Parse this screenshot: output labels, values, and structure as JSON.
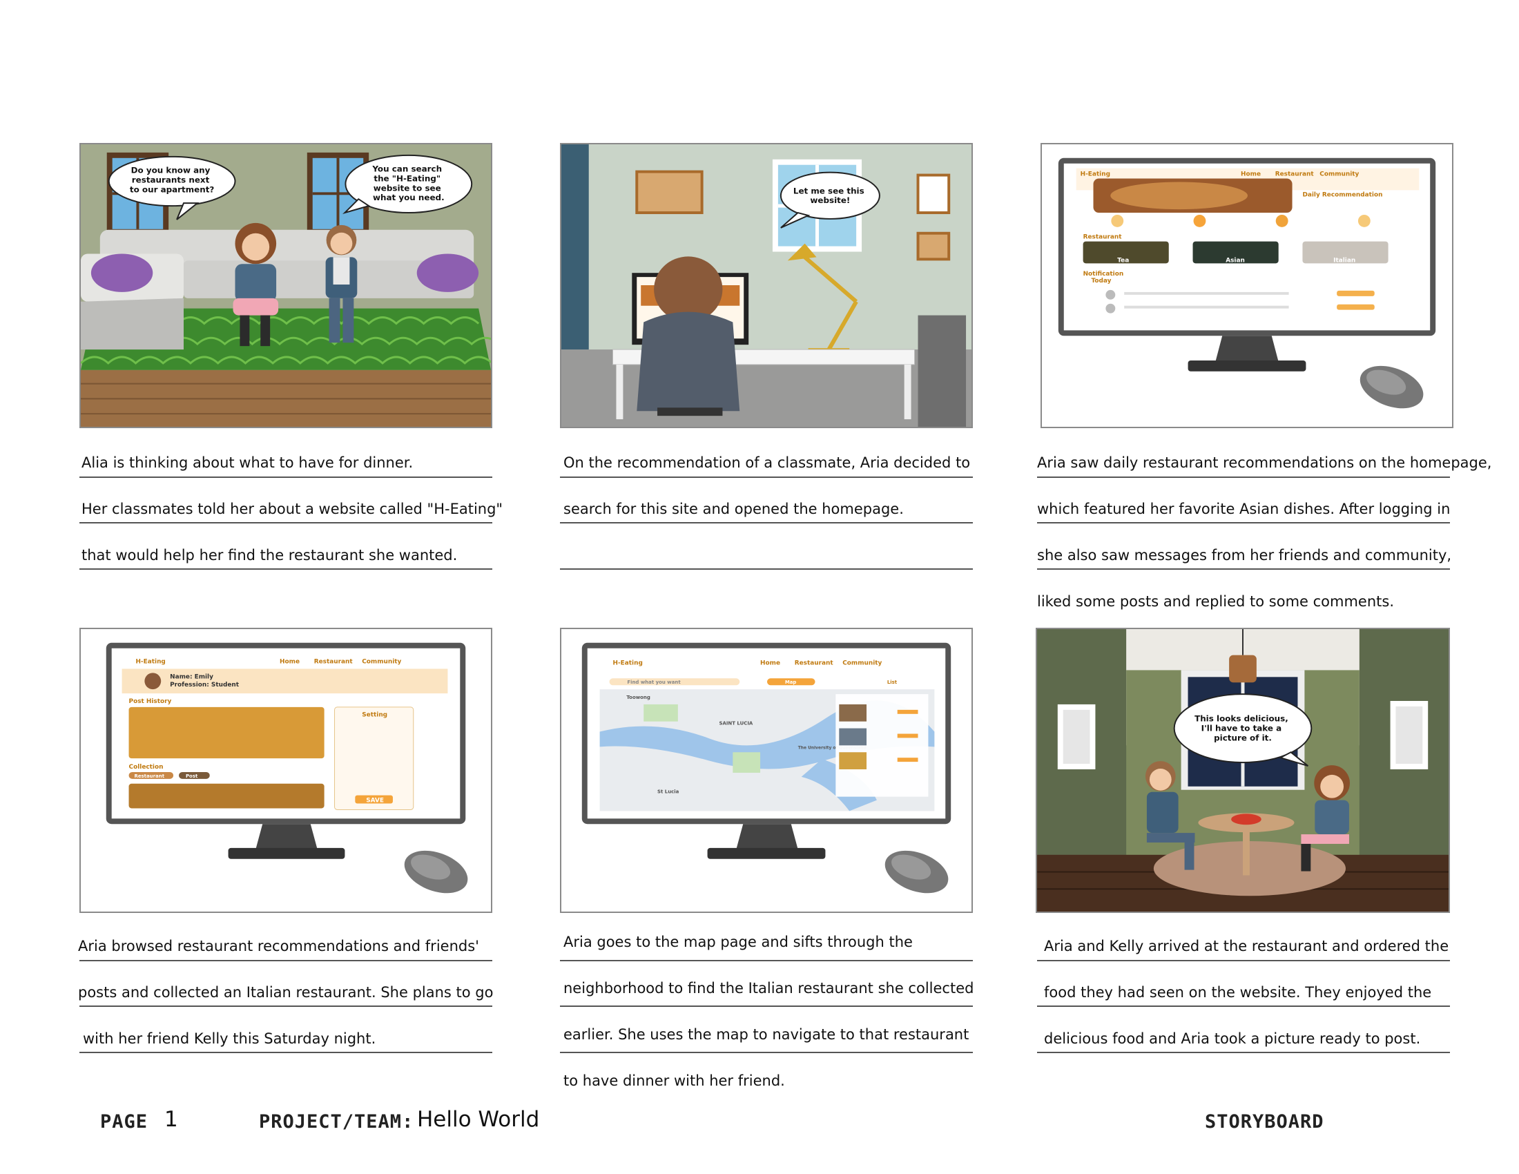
{
  "panels": [
    {
      "id": 1,
      "bubbles": [
        [
          "Do you know any",
          "restaurants next",
          "to our apartment?"
        ],
        [
          "You can search",
          "the \"H-Eating\"",
          "website to see",
          "what you need."
        ]
      ],
      "caption": [
        "Alia is thinking about what to have for dinner.",
        "Her classmates told her about a website called \"H-Eating\"",
        "that would help her find the restaurant she wanted."
      ]
    },
    {
      "id": 2,
      "bubbles": [
        [
          "Let me see this",
          "website!"
        ]
      ],
      "caption": [
        "On the recommendation of a classmate, Aria decided to",
        "search for this site and opened the homepage.",
        ""
      ]
    },
    {
      "id": 3,
      "screen": {
        "brand": "H-Eating",
        "nav": [
          "Home",
          "Restaurant",
          "Community"
        ],
        "hero_title": "Daily Recommendation",
        "section_restaurant": "Restaurant",
        "section_notification": "Notification",
        "today": "Today",
        "food_labels": [
          "Tea",
          "Asian",
          "Italian"
        ]
      },
      "caption": [
        "Aria saw daily restaurant recommendations on the homepage,",
        "which featured her favorite Asian dishes. After logging in",
        "she also saw messages from her friends and community,",
        "liked some posts and replied to some comments."
      ]
    },
    {
      "id": 4,
      "screen": {
        "brand": "H-Eating",
        "nav": [
          "Home",
          "Restaurant",
          "Community"
        ],
        "profile_name": "Name: Emily",
        "profile_role": "Profession: Student",
        "post_history": "Post History",
        "collection": "Collection",
        "collection_tabs": [
          "Restaurant",
          "Post"
        ],
        "setting": "Setting",
        "save": "SAVE"
      },
      "caption": [
        "Aria browsed restaurant recommendations and friends'",
        "posts and collected an Italian restaurant. She plans to go",
        "with her friend Kelly this Saturday night."
      ]
    },
    {
      "id": 5,
      "screen": {
        "brand": "H-Eating",
        "nav": [
          "Home",
          "Restaurant",
          "Community"
        ],
        "search_placeholder": "Find what you want",
        "tabs": [
          "Map",
          "List"
        ],
        "map_labels": [
          "Toowong",
          "SAINT LUCIA",
          "The University of Queensland",
          "St Lucia"
        ]
      },
      "caption": [
        "Aria goes to the map page and sifts through the",
        "neighborhood to find the Italian restaurant she collected",
        "earlier. She uses the map to navigate to that restaurant",
        "to have dinner with her friend."
      ]
    },
    {
      "id": 6,
      "bubbles": [
        [
          "This looks delicious,",
          "I'll have to take a",
          "picture of it."
        ]
      ],
      "caption": [
        "Aria and Kelly arrived at the restaurant and ordered the",
        "food they had seen on the website. They enjoyed the",
        "delicious food and Aria took a picture ready to post."
      ]
    }
  ],
  "footer": {
    "page_label": "PAGE",
    "page_number": "1",
    "project_label": "PROJECT/TEAM:",
    "project_name": "Hello World",
    "doc_type": "STORYBOARD"
  }
}
